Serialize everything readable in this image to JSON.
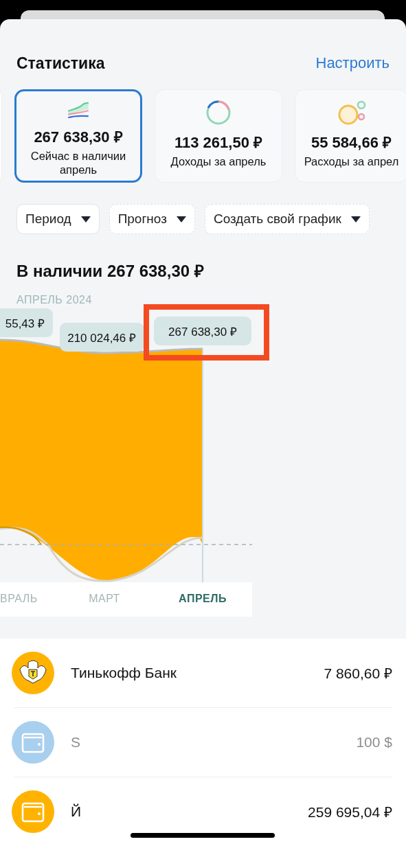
{
  "header": {
    "title": "Статистика",
    "action": "Настроить"
  },
  "cards": [
    {
      "kind": "waves",
      "value": "267 638,30 ₽",
      "label": "Сейчас в наличии апрель",
      "selected": true
    },
    {
      "kind": "ring",
      "value": "113 261,50 ₽",
      "label": "Доходы за апрель",
      "selected": false
    },
    {
      "kind": "bubbles",
      "value": "55 584,66 ₽",
      "label": "Расходы за апрел",
      "selected": false
    }
  ],
  "filters": [
    {
      "label": "Период",
      "kind": "solid"
    },
    {
      "label": "Прогноз",
      "kind": "dashed"
    },
    {
      "label": "Создать свой график",
      "kind": "dashed"
    }
  ],
  "chart": {
    "title": "В наличии 267 638,30 ₽",
    "period": "АПРЕЛЬ 2024",
    "tooltips": [
      {
        "text": "55,43 ₽",
        "highlighted": false
      },
      {
        "text": "210 024,46 ₽",
        "highlighted": false
      },
      {
        "text": "267 638,30 ₽",
        "highlighted": true
      }
    ],
    "x_labels": [
      {
        "label": "ВРАЛЬ",
        "selected": false
      },
      {
        "label": "МАРТ",
        "selected": false
      },
      {
        "label": "АПРЕЛЬ",
        "selected": true
      }
    ]
  },
  "accounts": [
    {
      "kind": "bank",
      "name": "Тинькофф Банк",
      "amount": "7 860,60 ₽",
      "color": "#ffb300",
      "muted": false
    },
    {
      "kind": "wallet",
      "name": "S",
      "amount": "100 $",
      "color": "#a8cfee",
      "muted": true
    },
    {
      "kind": "wallet",
      "name": "Й",
      "amount": "259 695,04 ₽",
      "color": "#ffb300",
      "muted": false
    }
  ]
}
